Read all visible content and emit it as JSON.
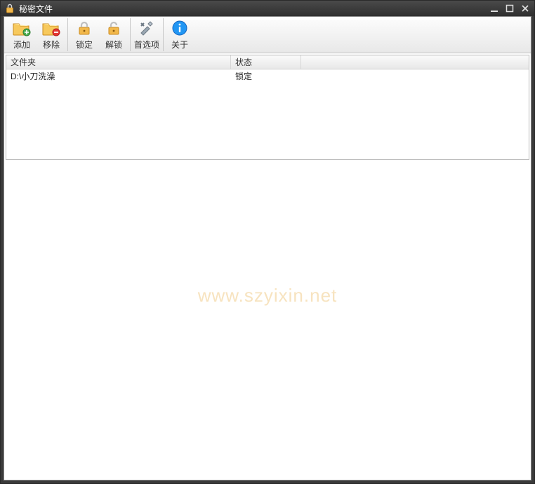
{
  "window": {
    "title": "秘密文件"
  },
  "toolbar": {
    "add": "添加",
    "remove": "移除",
    "lock": "锁定",
    "unlock": "解锁",
    "prefs": "首选项",
    "about": "关于"
  },
  "columns": {
    "folder": "文件夹",
    "status": "状态"
  },
  "rows": [
    {
      "folder": "D:\\小刀洗澡",
      "status": "锁定"
    }
  ],
  "watermark": "www.szyixin.net"
}
